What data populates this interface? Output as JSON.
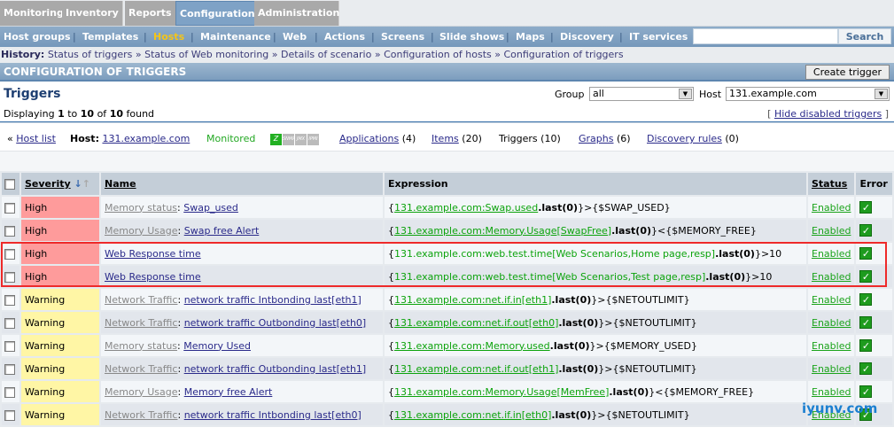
{
  "top_tabs": [
    "Monitoring",
    "Inventory",
    "Reports",
    "Configuration",
    "Administration"
  ],
  "sub_menu": [
    "Host groups",
    "Templates",
    "Hosts",
    "Maintenance",
    "Web",
    "Actions",
    "Screens",
    "Slide shows",
    "Maps",
    "Discovery",
    "IT services"
  ],
  "search_button": "Search",
  "history": {
    "label": "History:",
    "items": [
      "Status of triggers",
      "Status of Web monitoring",
      "Details of scenario",
      "Configuration of hosts",
      "Configuration of triggers"
    ],
    "sep": "»"
  },
  "header": {
    "title": "CONFIGURATION OF TRIGGERS",
    "create_button": "Create trigger"
  },
  "page": {
    "title": "Triggers",
    "displaying": "Displaying",
    "from": "1",
    "to_word": "to",
    "to": "10",
    "of_word": "of",
    "total": "10",
    "found": "found",
    "group_label": "Group",
    "group_value": "all",
    "host_label": "Host",
    "host_value": "131.example.com",
    "hide_link": "Hide disabled triggers"
  },
  "hostbar": {
    "host_list": "Host list",
    "host_label": "Host:",
    "host": "131.example.com",
    "status": "Monitored",
    "icons": [
      "Z",
      "SNMP",
      "JMX",
      "IPMI"
    ],
    "applications": "Applications",
    "applications_count": "(4)",
    "items": "Items",
    "items_count": "(20)",
    "triggers": "Triggers (10)",
    "graphs": "Graphs",
    "graphs_count": "(6)",
    "discovery": "Discovery rules",
    "discovery_count": "(0)"
  },
  "columns": {
    "severity": "Severity",
    "name": "Name",
    "expression": "Expression",
    "status": "Status",
    "error": "Error"
  },
  "rows": [
    {
      "severity": "High",
      "app": "Memory status",
      "name": "Swap_used",
      "expr_link": "131.example.com:Swap.used",
      "expr_func": ".last(0)",
      "expr_rest": "}>{$SWAP_USED}",
      "status": "Enabled"
    },
    {
      "severity": "High",
      "app": "Memory Usage",
      "name": "Swap free Alert",
      "expr_link": "131.example.com:Memory.Usage[SwapFree]",
      "expr_func": ".last(0)",
      "expr_rest": "}<{$MEMORY_FREE}",
      "status": "Enabled"
    },
    {
      "severity": "High",
      "app": "",
      "name": "Web Response time",
      "expr_link": "131.example.com:web.test.time[Web Scenarios,Home page,resp]",
      "expr_func": ".last(0)",
      "expr_rest": "}>10",
      "status": "Enabled"
    },
    {
      "severity": "High",
      "app": "",
      "name": "Web Response time",
      "expr_link": "131.example.com:web.test.time[Web Scenarios,Test page,resp]",
      "expr_func": ".last(0)",
      "expr_rest": "}>10",
      "status": "Enabled"
    },
    {
      "severity": "Warning",
      "app": "Network Traffic",
      "name": "network traffic Intbonding last[eth1]",
      "expr_link": "131.example.com:net.if.in[eth1]",
      "expr_func": ".last(0)",
      "expr_rest": "}>{$NETOUTLIMIT}",
      "status": "Enabled"
    },
    {
      "severity": "Warning",
      "app": "Network Traffic",
      "name": "network traffic Outbonding last[eth0]",
      "expr_link": "131.example.com:net.if.out[eth0]",
      "expr_func": ".last(0)",
      "expr_rest": "}>{$NETOUTLIMIT}",
      "status": "Enabled"
    },
    {
      "severity": "Warning",
      "app": "Memory status",
      "name": "Memory Used",
      "expr_link": "131.example.com:Memory.used",
      "expr_func": ".last(0)",
      "expr_rest": "}>{$MEMORY_USED}",
      "status": "Enabled"
    },
    {
      "severity": "Warning",
      "app": "Network Traffic",
      "name": "network traffic Outbonding last[eth1]",
      "expr_link": "131.example.com:net.if.out[eth1]",
      "expr_func": ".last(0)",
      "expr_rest": "}>{$NETOUTLIMIT}",
      "status": "Enabled"
    },
    {
      "severity": "Warning",
      "app": "Memory Usage",
      "name": "Memory free Alert",
      "expr_link": "131.example.com:Memory.Usage[MemFree]",
      "expr_func": ".last(0)",
      "expr_rest": "}<{$MEMORY_FREE}",
      "status": "Enabled"
    },
    {
      "severity": "Warning",
      "app": "Network Traffic",
      "name": "network traffic Intbonding last[eth0]",
      "expr_link": "131.example.com:net.if.in[eth0]",
      "expr_func": ".last(0)",
      "expr_rest": "}>{$NETOUTLIMIT}",
      "status": "Enabled"
    }
  ],
  "watermark": "iyunv.com",
  "colors": {
    "high": "#fe9b9b",
    "warning": "#fff6a5",
    "green": "#0ca30c"
  }
}
